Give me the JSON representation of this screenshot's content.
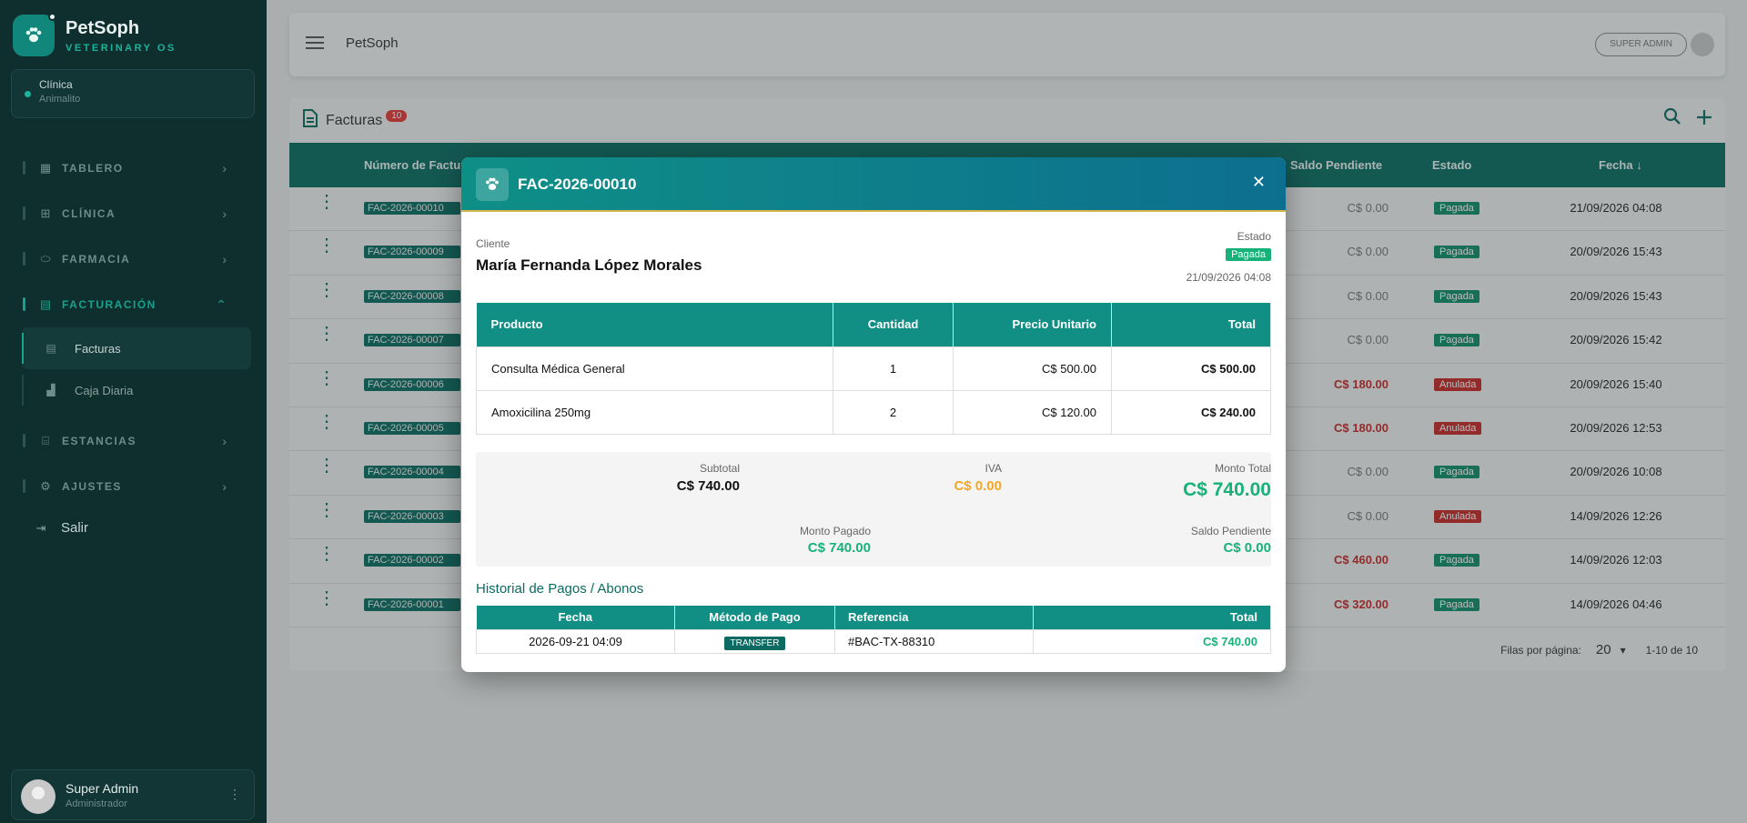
{
  "app": {
    "name": "PetSoph",
    "subtitle": "VETERINARY OS"
  },
  "clinic": {
    "label": "Clínica",
    "value": "Animalito"
  },
  "nav": {
    "items": [
      {
        "label": "TABLERO",
        "icon": "dashboard-icon"
      },
      {
        "label": "CLÍNICA",
        "icon": "clinic-icon"
      },
      {
        "label": "FARMACIA",
        "icon": "pill-icon"
      },
      {
        "label": "FACTURACIÓN",
        "icon": "billing-icon"
      },
      {
        "label": "ESTANCIAS",
        "icon": "bed-icon"
      },
      {
        "label": "AJUSTES",
        "icon": "gear-icon"
      }
    ],
    "sub": [
      {
        "label": "Facturas"
      },
      {
        "label": "Caja Diaria"
      }
    ],
    "logout": "Salir"
  },
  "user": {
    "name": "Super Admin",
    "role": "Administrador"
  },
  "topbar": {
    "title": "PetSoph",
    "role_badge": "SUPER ADMIN"
  },
  "invoices": {
    "title": "Facturas",
    "count": "10",
    "columns": {
      "number": "Número de Factura",
      "balance": "Saldo Pendiente",
      "status": "Estado",
      "date": "Fecha"
    },
    "rows": [
      {
        "number": "FAC-2026-00010",
        "balance": "C$ 0.00",
        "status": "Pagada",
        "date": "21/09/2026 04:08"
      },
      {
        "number": "FAC-2026-00009",
        "balance": "C$ 0.00",
        "status": "Pagada",
        "date": "20/09/2026 15:43"
      },
      {
        "number": "FAC-2026-00008",
        "balance": "C$ 0.00",
        "status": "Pagada",
        "date": "20/09/2026 15:43"
      },
      {
        "number": "FAC-2026-00007",
        "balance": "C$ 0.00",
        "status": "Pagada",
        "date": "20/09/2026 15:42"
      },
      {
        "number": "FAC-2026-00006",
        "balance": "C$ 180.00",
        "status": "Anulada",
        "date": "20/09/2026 15:40"
      },
      {
        "number": "FAC-2026-00005",
        "balance": "C$ 180.00",
        "status": "Anulada",
        "date": "20/09/2026 12:53"
      },
      {
        "number": "FAC-2026-00004",
        "balance": "C$ 0.00",
        "status": "Pagada",
        "date": "20/09/2026 10:08"
      },
      {
        "number": "FAC-2026-00003",
        "balance": "C$ 0.00",
        "status": "Anulada",
        "date": "14/09/2026 12:26"
      },
      {
        "number": "FAC-2026-00002",
        "balance": "C$ 460.00",
        "status": "Pagada",
        "date": "14/09/2026 12:03"
      },
      {
        "number": "FAC-2026-00001",
        "balance": "C$ 320.00",
        "status": "Pagada",
        "date": "14/09/2026 04:46"
      }
    ],
    "pager": {
      "label": "Filas por página:",
      "size": "20",
      "range": "1-10 de 10"
    }
  },
  "modal": {
    "title": "FAC-2026-00010",
    "client_label": "Cliente",
    "client_name": "María Fernanda López Morales",
    "status_label": "Estado",
    "status": "Pagada",
    "date": "21/09/2026 04:08",
    "columns": {
      "product": "Producto",
      "qty": "Cantidad",
      "unit": "Precio Unitario",
      "total": "Total"
    },
    "items": [
      {
        "product": "Consulta Médica General",
        "qty": "1",
        "unit": "C$ 500.00",
        "total": "C$ 500.00"
      },
      {
        "product": "Amoxicilina 250mg",
        "qty": "2",
        "unit": "C$ 120.00",
        "total": "C$ 240.00"
      }
    ],
    "summary": {
      "subtotal_label": "Subtotal",
      "subtotal": "C$ 740.00",
      "iva_label": "IVA",
      "iva": "C$ 0.00",
      "total_label": "Monto Total",
      "total": "C$ 740.00",
      "paid_label": "Monto Pagado",
      "paid": "C$ 740.00",
      "pending_label": "Saldo Pendiente",
      "pending": "C$ 0.00"
    },
    "history_title": "Historial de Pagos / Abonos",
    "history_columns": {
      "date": "Fecha",
      "method": "Método de Pago",
      "ref": "Referencia",
      "total": "Total"
    },
    "history": [
      {
        "date": "2026-09-21 04:09",
        "method": "TRANSFER",
        "ref": "#BAC-TX-88310",
        "total": "C$ 740.00"
      }
    ]
  },
  "colors": {
    "primary": "#0b6b62",
    "accent": "#17b27a",
    "danger": "#c62828",
    "warning": "#f5a623"
  }
}
